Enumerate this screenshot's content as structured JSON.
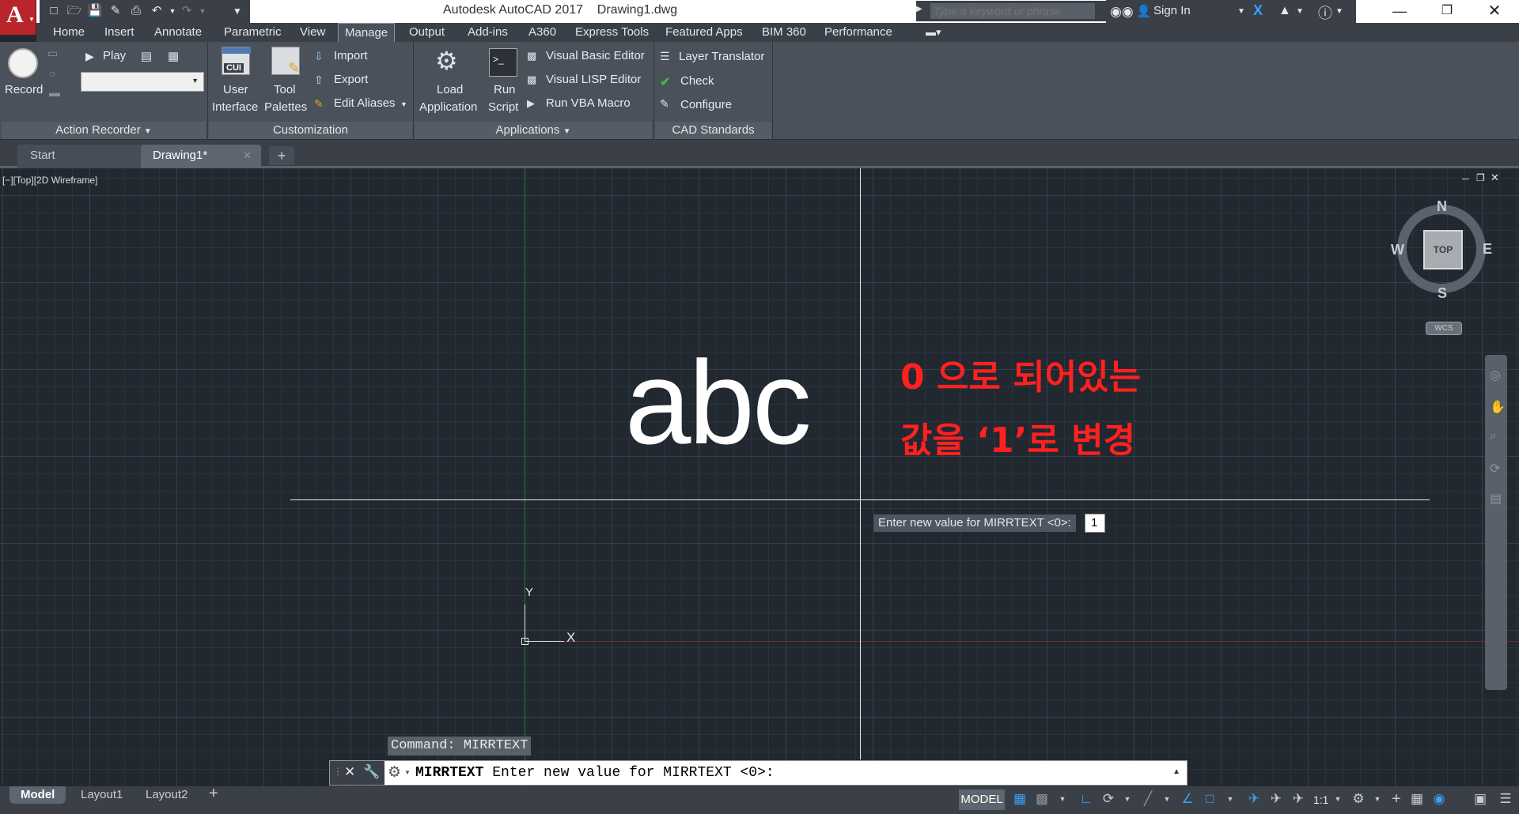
{
  "app": {
    "logo": "A",
    "title": "Autodesk AutoCAD 2017    Drawing1.dwg"
  },
  "search": {
    "placeholder": "Type a keyword or phrase"
  },
  "account": {
    "sign_in": "Sign In"
  },
  "ribbon_tabs": [
    "Home",
    "Insert",
    "Annotate",
    "Parametric",
    "View",
    "Manage",
    "Output",
    "Add-ins",
    "A360",
    "Express Tools",
    "Featured Apps",
    "BIM 360",
    "Performance"
  ],
  "active_tab": "Manage",
  "ribbon": {
    "action_recorder": {
      "record": "Record",
      "play": "Play",
      "title": "Action Recorder"
    },
    "customization": {
      "user_interface_1": "User",
      "user_interface_2": "Interface",
      "tool_palettes_1": "Tool",
      "tool_palettes_2": "Palettes",
      "import": "Import",
      "export": "Export",
      "edit_aliases": "Edit Aliases",
      "title": "Customization",
      "cui_icon_text": "CUI"
    },
    "applications": {
      "load_1": "Load",
      "load_2": "Application",
      "run_1": "Run",
      "run_2": "Script",
      "vba_editor": "Visual Basic Editor",
      "lisp_editor": "Visual LISP Editor",
      "vba_macro": "Run VBA Macro",
      "title": "Applications"
    },
    "cad_standards": {
      "layer_translator": "Layer Translator",
      "check": "Check",
      "configure": "Configure",
      "title": "CAD Standards"
    }
  },
  "file_tabs": {
    "start": "Start",
    "drawing": "Drawing1*"
  },
  "viewport": {
    "label": "[−][Top][2D Wireframe]",
    "drawing_text": "abc",
    "annotation_line1": "0 으로 되어있는",
    "annotation_line2": "값을 ‘1’로 변경",
    "tooltip_prompt": "Enter new value for MIRRTEXT <0>:",
    "tooltip_value": "1",
    "ucs_x": "X",
    "ucs_y": "Y",
    "annotation_color": "#ff2020"
  },
  "viewcube": {
    "north": "N",
    "south": "S",
    "east": "E",
    "west": "W",
    "top": "TOP",
    "wcs": "WCS"
  },
  "command": {
    "history": "Command: MIRRTEXT",
    "current_cmd": "MIRRTEXT",
    "prompt": "Enter new value for MIRRTEXT <0>:"
  },
  "layout_tabs": [
    "Model",
    "Layout1",
    "Layout2"
  ],
  "status": {
    "model": "MODEL",
    "scale": "1:1"
  }
}
